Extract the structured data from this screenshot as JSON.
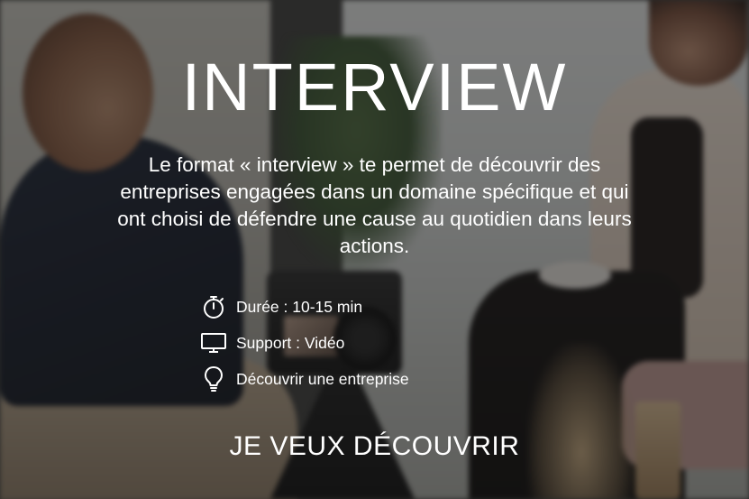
{
  "card": {
    "title": "INTERVIEW",
    "description": "Le format « interview » te permet de découvrir des entreprises engagées dans un domaine spécifique et qui ont choisi de défendre une cause au quotidien dans leurs actions.",
    "details": [
      {
        "icon": "stopwatch-icon",
        "label": "Durée : 10-15 min"
      },
      {
        "icon": "monitor-icon",
        "label": "Support : Vidéo"
      },
      {
        "icon": "lightbulb-icon",
        "label": "Découvrir une entreprise"
      }
    ],
    "cta_label": "JE VEUX DÉCOUVRIR"
  },
  "colors": {
    "text": "#ffffff",
    "overlay": "rgba(24,24,24,0.52)"
  }
}
